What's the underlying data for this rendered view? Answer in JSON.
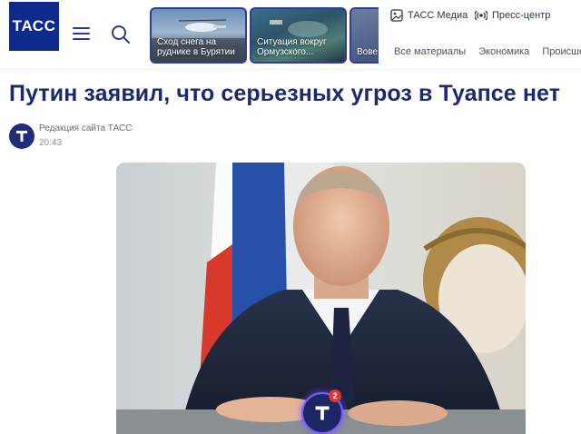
{
  "header": {
    "logo_text": "ТАСС",
    "cards": [
      {
        "caption": "Сход снега на руднике в Бурятии"
      },
      {
        "caption": "Ситуация вокруг Ормузского..."
      },
      {
        "caption": "Вове на У"
      }
    ],
    "top_links": [
      {
        "label": "ТАСС Медиа",
        "icon": "image-icon"
      },
      {
        "label": "Пресс-центр",
        "icon": "broadcast-icon"
      }
    ],
    "sections": [
      "Все материалы",
      "Экономика",
      "Происше"
    ]
  },
  "article": {
    "title": "Путин заявил, что серьезных угроз в Туапсе нет",
    "author": "Редакция сайта ТАСС",
    "time": "20:43"
  },
  "badge": {
    "count": "2"
  }
}
